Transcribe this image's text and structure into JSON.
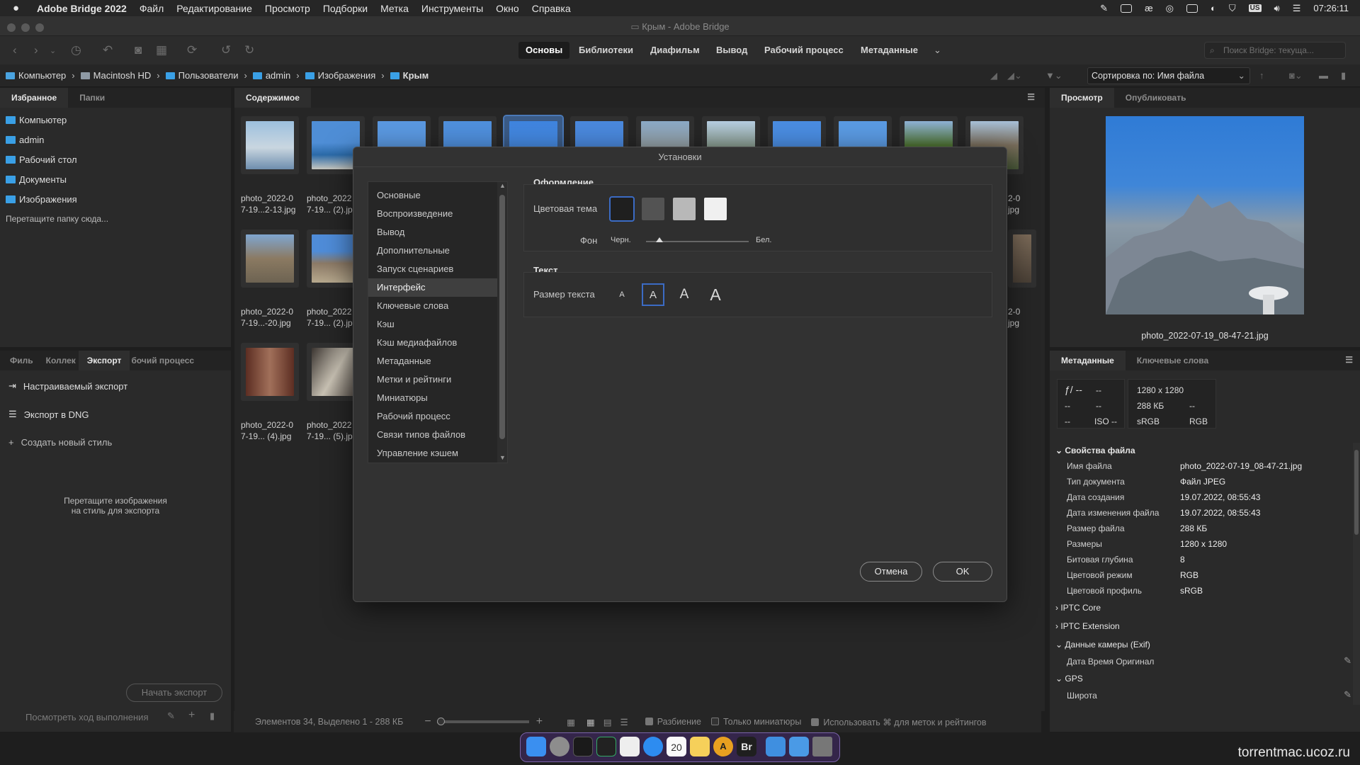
{
  "menubar": {
    "app": "Adobe Bridge 2022",
    "items": [
      "Файл",
      "Редактирование",
      "Просмотр",
      "Подборки",
      "Метка",
      "Инструменты",
      "Окно",
      "Справка"
    ],
    "clock": "07:26:11",
    "kbd": "US"
  },
  "window": {
    "title": "Крым - Adobe Bridge"
  },
  "toolbar": {
    "workspaces": [
      "Основы",
      "Библиотеки",
      "Диафильм",
      "Вывод",
      "Рабочий процесс",
      "Метаданные"
    ],
    "search_placeholder": "Поиск Bridge: текуща..."
  },
  "path": [
    "Компьютер",
    "Macintosh HD",
    "Пользователи",
    "admin",
    "Изображения",
    "Крым"
  ],
  "sort": "Сортировка по: Имя файла",
  "left": {
    "tabs": [
      "Избранное",
      "Папки"
    ],
    "favorites": [
      "Компьютер",
      "admin",
      "Рабочий стол",
      "Документы",
      "Изображения"
    ],
    "drop_hint": "Перетащите папку сюда...",
    "bottom_tabs": [
      "Филь",
      "Коллек",
      "Экспорт",
      "бочий процесс"
    ],
    "export_items": [
      "Настраиваемый экспорт",
      "Экспорт в DNG",
      "Создать новый стиль"
    ],
    "export_hint_1": "Перетащите изображения",
    "export_hint_2": "на стиль для экспорта",
    "start_export": "Начать экспорт",
    "progress": "Посмотреть ход выполнения"
  },
  "content": {
    "tab": "Содержимое",
    "row1": [
      {
        "l1": "photo_2022-0",
        "l2": "7-19...2-13.jpg"
      },
      {
        "l1": "photo_2022",
        "l2": "7-19... (2).jpg"
      }
    ],
    "row1_right": {
      "l1": "2-0",
      "l2": "jpg"
    },
    "row2": [
      {
        "l1": "photo_2022-0",
        "l2": "7-19...-20.jpg"
      },
      {
        "l1": "photo_2022",
        "l2": "7-19... (2).jpg"
      }
    ],
    "row2_right": {
      "l1": "2-0",
      "l2": "jpg"
    },
    "row3": [
      {
        "l1": "photo_2022-0",
        "l2": "7-19... (4).jpg"
      },
      {
        "l1": "photo_2022",
        "l2": "7-19... (5).jpg"
      }
    ],
    "status": "Элементов 34, Выделено 1 - 288 КБ",
    "opt_split": "Разбиение",
    "opt_thumbs": "Только миниатюры",
    "opt_use": "Использовать ⌘ для меток и рейтингов"
  },
  "right": {
    "tabs": [
      "Просмотр",
      "Опубликовать"
    ],
    "preview_name": "photo_2022-07-19_08-47-21.jpg",
    "meta_tabs": [
      "Метаданные",
      "Ключевые слова"
    ],
    "cam": {
      "f": "ƒ/ --",
      "f2": "--",
      "a": "--",
      "b": "--",
      "c": "--",
      "iso": "ISO --"
    },
    "info": {
      "dims": "1280 x 1280",
      "size": "288 КБ",
      "dash": "--",
      "cs": "sRGB",
      "mode": "RGB"
    },
    "sections": {
      "file": "Свойства файла",
      "iptc": "IPTC Core",
      "iptcx": "IPTC Extension",
      "exif": "Данные камеры (Exif)",
      "gps": "GPS"
    },
    "props": [
      [
        "Имя файла",
        "photo_2022-07-19_08-47-21.jpg"
      ],
      [
        "Тип документа",
        "Файл JPEG"
      ],
      [
        "Дата создания",
        "19.07.2022, 08:55:43"
      ],
      [
        "Дата изменения файла",
        "19.07.2022, 08:55:43"
      ],
      [
        "Размер файла",
        "288 КБ"
      ],
      [
        "Размеры",
        "1280 x 1280"
      ],
      [
        "Битовая глубина",
        "8"
      ],
      [
        "Цветовой режим",
        "RGB"
      ],
      [
        "Цветовой профиль",
        "sRGB"
      ]
    ],
    "exif_row": "Дата Время Оригинал",
    "gps_row": "Широта"
  },
  "dialog": {
    "title": "Установки",
    "categories": [
      "Основные",
      "Воспроизведение",
      "Вывод",
      "Дополнительные",
      "Запуск сценариев",
      "Интерфейс",
      "Ключевые слова",
      "Кэш",
      "Кэш медиафайлов",
      "Метаданные",
      "Метки и рейтинги",
      "Миниатюры",
      "Рабочий процесс",
      "Связи типов файлов",
      "Управление кэшем"
    ],
    "selected": "Интерфейс",
    "appearance": "Оформление",
    "theme_label": "Цветовая тема",
    "bg_label": "Фон",
    "black": "Черн.",
    "white": "Бел.",
    "text": "Текст",
    "size_label": "Размер текста",
    "size_glyph": "A",
    "cancel": "Отмена",
    "ok": "OK"
  },
  "watermark": "torrentmac.ucoz.ru"
}
